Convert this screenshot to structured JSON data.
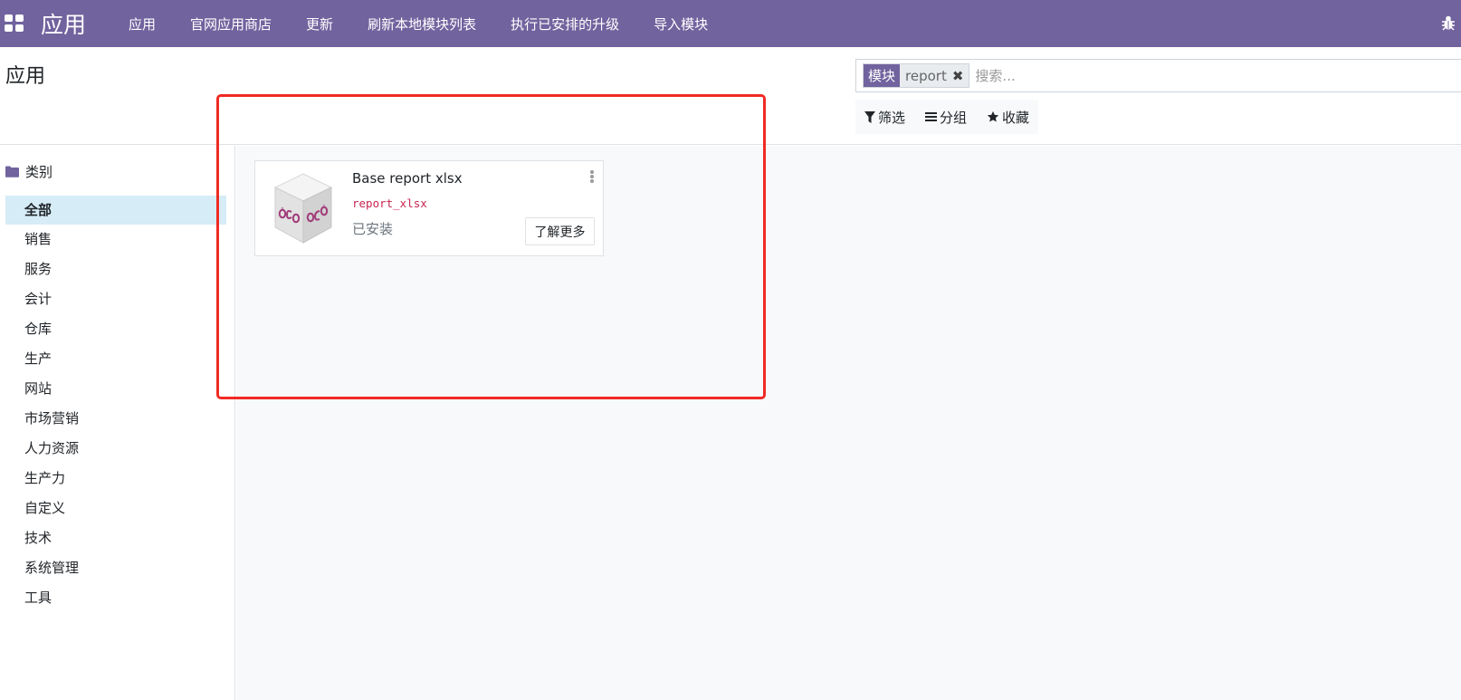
{
  "navbar": {
    "brand": "应用",
    "items": [
      {
        "label": "应用"
      },
      {
        "label": "官网应用商店"
      },
      {
        "label": "更新"
      },
      {
        "label": "刷新本地模块列表"
      },
      {
        "label": "执行已安排的升级"
      },
      {
        "label": "导入模块"
      }
    ],
    "apps_icon": "grid-icon",
    "debug_icon": "bug-icon"
  },
  "control_panel": {
    "title": "应用",
    "search": {
      "facet_label": "模块",
      "facet_value": "report",
      "facet_remove_glyph": "✖",
      "placeholder": "搜索..."
    },
    "filters": {
      "filter_label": "筛选",
      "group_label": "分组",
      "favorite_label": "收藏"
    }
  },
  "sidebar": {
    "header": "类别",
    "header_icon": "folder-icon",
    "items": [
      {
        "label": "全部",
        "active": true
      },
      {
        "label": "销售"
      },
      {
        "label": "服务"
      },
      {
        "label": "会计"
      },
      {
        "label": "仓库"
      },
      {
        "label": "生产"
      },
      {
        "label": "网站"
      },
      {
        "label": "市场营销"
      },
      {
        "label": "人力资源"
      },
      {
        "label": "生产力"
      },
      {
        "label": "自定义"
      },
      {
        "label": "技术"
      },
      {
        "label": "系统管理"
      },
      {
        "label": "工具"
      }
    ]
  },
  "modules": [
    {
      "name": "Base report xlsx",
      "technical_name": "report_xlsx",
      "status": "已安装",
      "action_label": "了解更多",
      "icon": "oca-module-box-icon"
    }
  ],
  "colors": {
    "brand": "#71639e",
    "technical_name": "#c7254e",
    "highlight": "#f02b24",
    "active_category": "#d6ecf7"
  }
}
